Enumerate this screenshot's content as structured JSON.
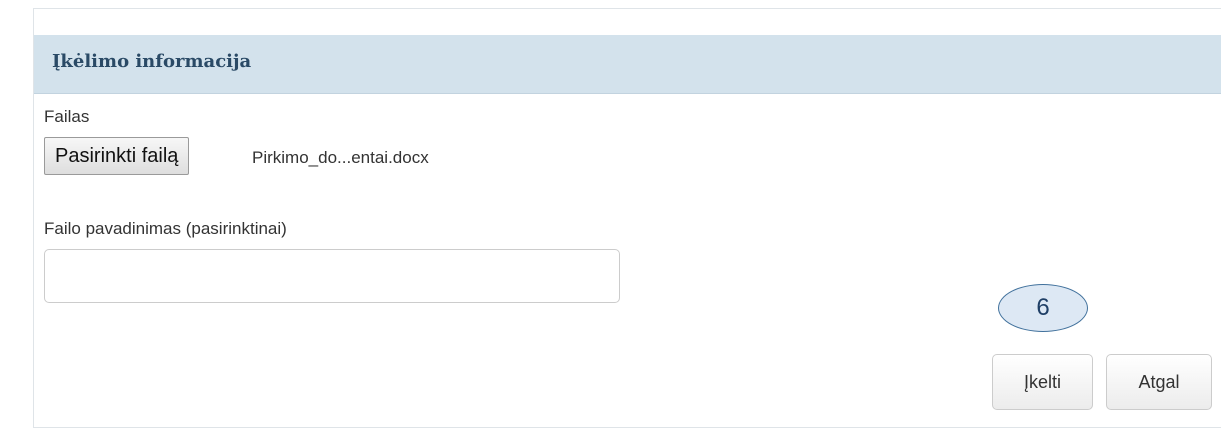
{
  "panel": {
    "title": "Įkėlimo informacija"
  },
  "file": {
    "label": "Failas",
    "choose_button": "Pasirinkti failą",
    "selected_file": "Pirkimo_do...entai.docx"
  },
  "filename_field": {
    "label": "Failo pavadinimas (pasirinktinai)",
    "value": "",
    "placeholder": ""
  },
  "annotation": {
    "step_number": "6"
  },
  "actions": {
    "upload_label": "Įkelti",
    "back_label": "Atgal"
  }
}
